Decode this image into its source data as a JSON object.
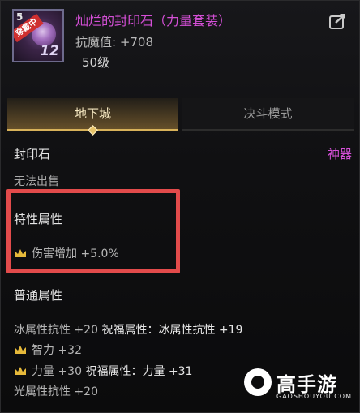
{
  "item": {
    "level_badge": "5",
    "equipped_tag": "穿戴中",
    "icon_number": "12",
    "name": "灿烂的封印石（力量套装）",
    "anti_magic": "抗魔值: +708",
    "required_level": "50级"
  },
  "tabs": [
    {
      "label": "地下城",
      "active": true
    },
    {
      "label": "决斗模式",
      "active": false
    }
  ],
  "item_type": "封印石",
  "item_grade": "神器",
  "sell_status": "无法出售",
  "special": {
    "title": "特性属性",
    "attrs": [
      {
        "text": "伤害增加 +5.0%"
      }
    ]
  },
  "normal": {
    "title": "普通属性",
    "rows": [
      {
        "text": "冰属性抗性 +20",
        "bless": "祝福属性：冰属性抗性 +19",
        "crown": false
      },
      {
        "text": "智力 +32",
        "bless": "",
        "crown": true
      },
      {
        "text": "力量 +30",
        "bless": "祝福属性：力量 +31",
        "crown": true
      },
      {
        "text": "光属性抗性 +20",
        "bless": "",
        "crown": false
      }
    ]
  },
  "watermark": {
    "brand": "高手游",
    "domain": "GAOSHOUYOU.COM"
  },
  "colors": {
    "item_name": "#d44fd6",
    "grade": "#d44fd6",
    "highlight_frame": "#e24b4b",
    "crown": "#e6b93a"
  }
}
